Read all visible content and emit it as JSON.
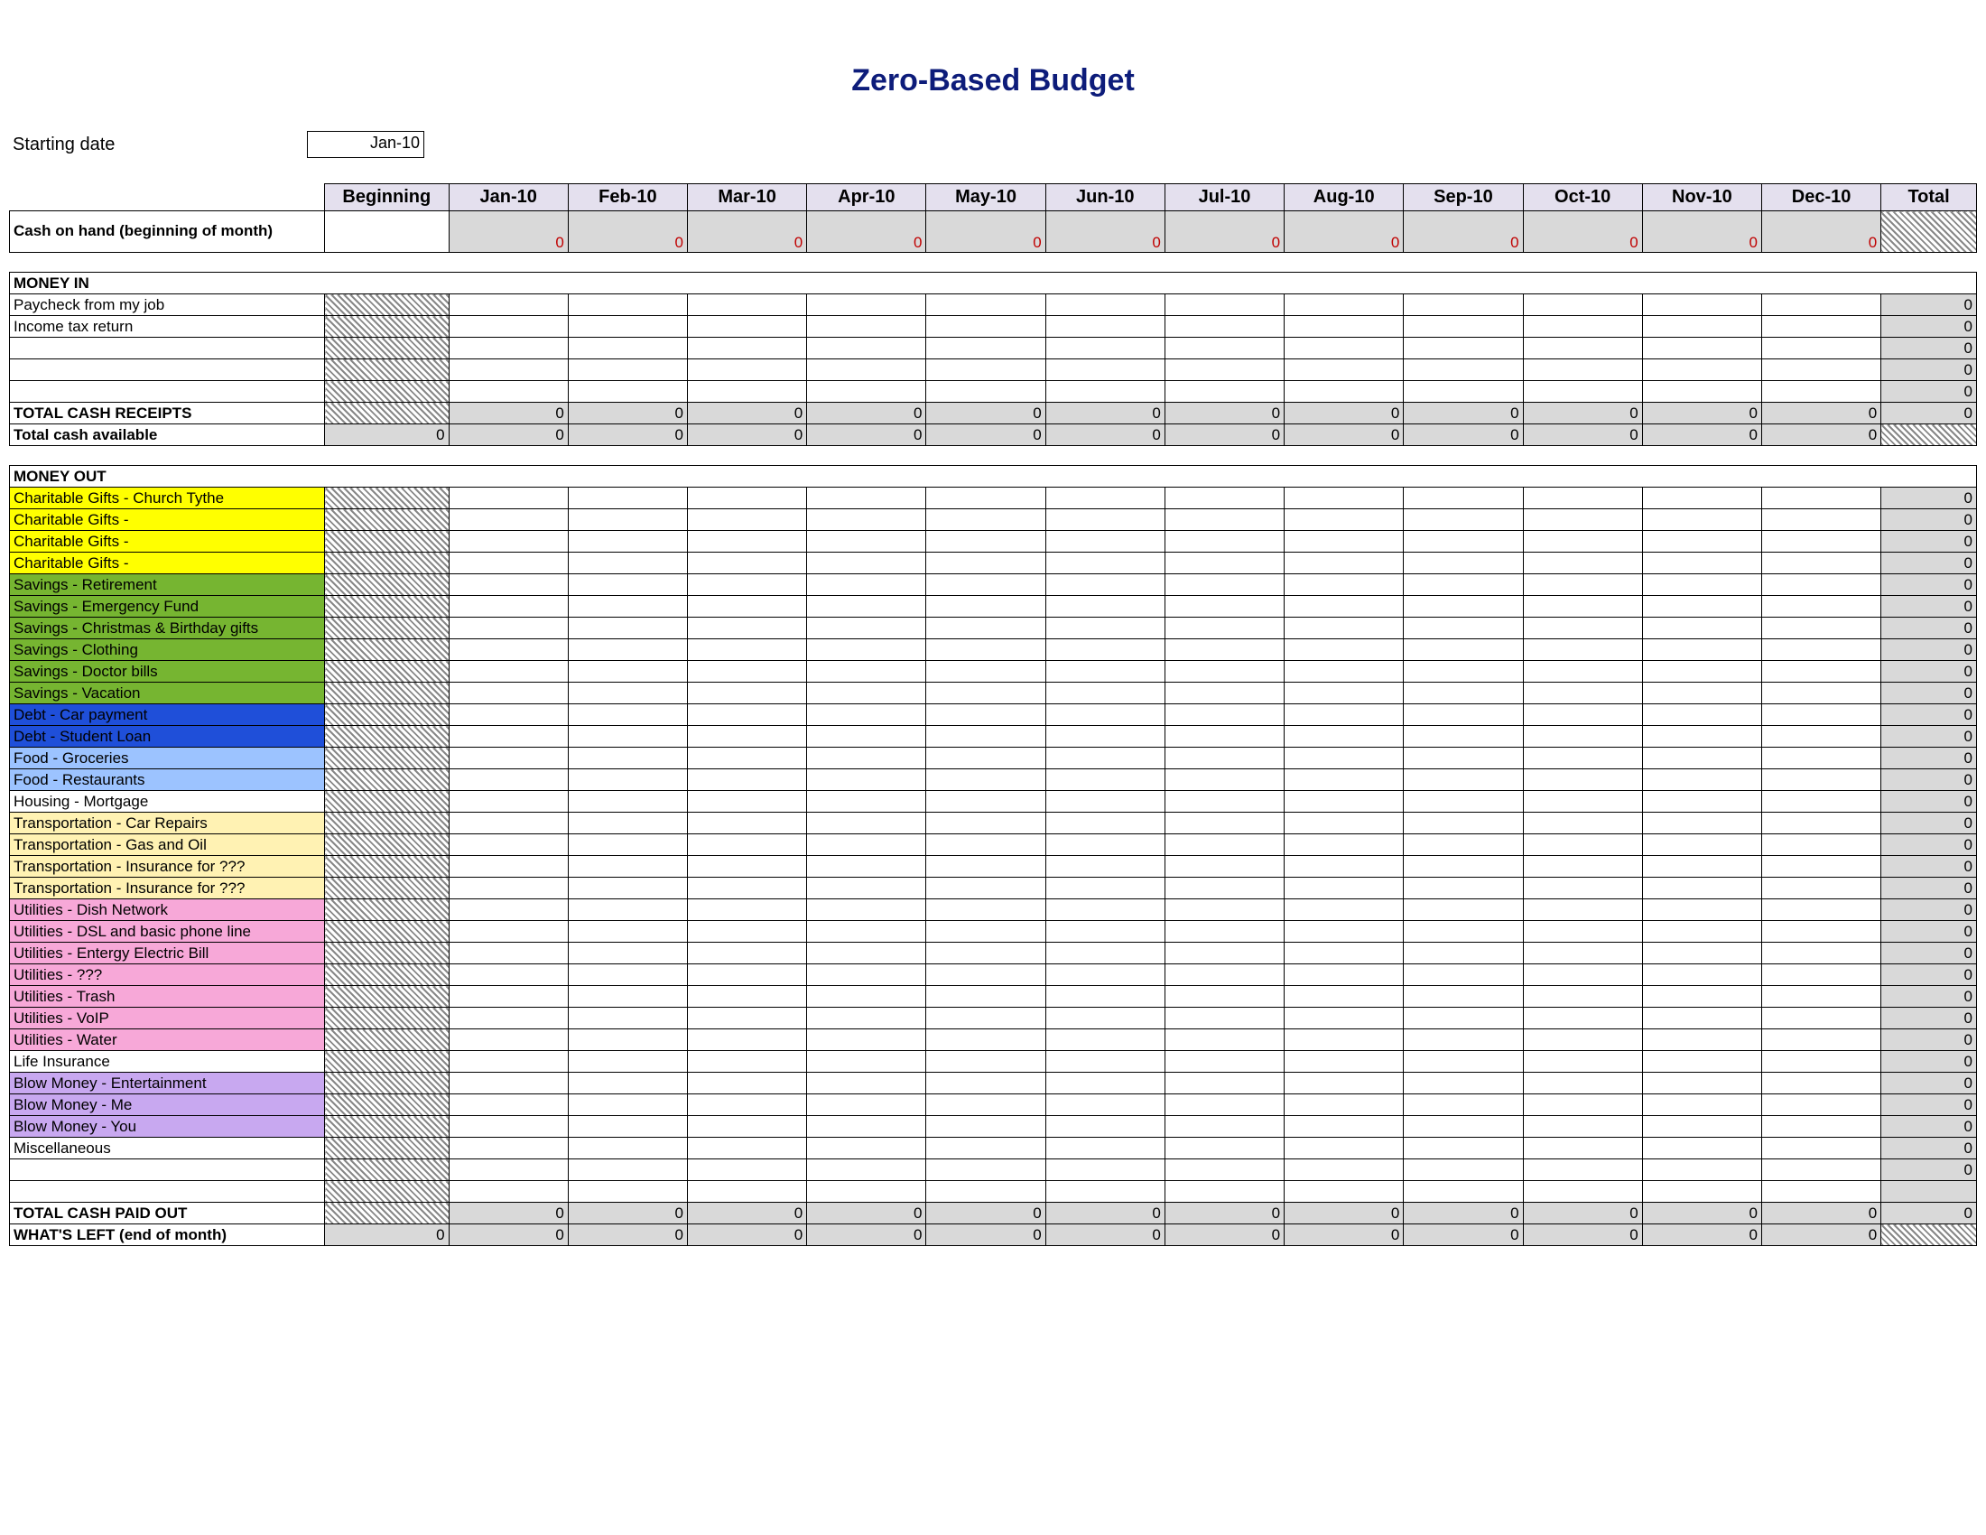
{
  "title": "Zero-Based Budget",
  "starting_date_label": "Starting date",
  "starting_date_value": "Jan-10",
  "columns": {
    "begin": "Beginning",
    "months": [
      "Jan-10",
      "Feb-10",
      "Mar-10",
      "Apr-10",
      "May-10",
      "Jun-10",
      "Jul-10",
      "Aug-10",
      "Sep-10",
      "Oct-10",
      "Nov-10",
      "Dec-10"
    ],
    "total": "Total"
  },
  "cash_on_hand_label": "Cash on hand (beginning of month)",
  "zero": "0",
  "sections": {
    "money_in": "MONEY IN",
    "money_out": "MONEY OUT"
  },
  "money_in_rows": [
    {
      "label": "Paycheck from my job",
      "total": "0"
    },
    {
      "label": "Income tax return",
      "total": "0"
    },
    {
      "label": "",
      "total": "0"
    },
    {
      "label": "",
      "total": "0"
    },
    {
      "label": "",
      "total": "0"
    }
  ],
  "total_cash_receipts_label": "TOTAL CASH RECEIPTS",
  "total_cash_available_label": "Total cash available",
  "money_out_rows": [
    {
      "label": "Charitable Gifts - Church Tythe",
      "color": "c-yellow",
      "total": "0"
    },
    {
      "label": "Charitable Gifts -",
      "color": "c-yellow",
      "total": "0"
    },
    {
      "label": "Charitable Gifts -",
      "color": "c-yellow",
      "total": "0"
    },
    {
      "label": "Charitable Gifts -",
      "color": "c-yellow",
      "total": "0"
    },
    {
      "label": "Savings - Retirement",
      "color": "c-green",
      "total": "0"
    },
    {
      "label": "Savings - Emergency Fund",
      "color": "c-green",
      "total": "0"
    },
    {
      "label": "Savings - Christmas & Birthday gifts",
      "color": "c-green",
      "total": "0"
    },
    {
      "label": "Savings - Clothing",
      "color": "c-green",
      "total": "0"
    },
    {
      "label": "Savings - Doctor bills",
      "color": "c-green",
      "total": "0"
    },
    {
      "label": "Savings - Vacation",
      "color": "c-green",
      "total": "0"
    },
    {
      "label": "Debt - Car payment",
      "color": "c-blue",
      "total": "0"
    },
    {
      "label": "Debt - Student Loan",
      "color": "c-blue",
      "total": "0"
    },
    {
      "label": "Food - Groceries",
      "color": "c-lblue",
      "total": "0"
    },
    {
      "label": "Food - Restaurants",
      "color": "c-lblue",
      "total": "0"
    },
    {
      "label": "Housing - Mortgage",
      "color": "c-white",
      "total": "0"
    },
    {
      "label": "Transportation - Car Repairs",
      "color": "c-cream",
      "total": "0"
    },
    {
      "label": "Transportation - Gas and Oil",
      "color": "c-cream",
      "total": "0"
    },
    {
      "label": "Transportation - Insurance for ???",
      "color": "c-cream",
      "total": "0"
    },
    {
      "label": "Transportation - Insurance for ???",
      "color": "c-cream",
      "total": "0"
    },
    {
      "label": "Utilities - Dish Network",
      "color": "c-pink",
      "total": "0"
    },
    {
      "label": "Utilities - DSL and basic phone line",
      "color": "c-pink",
      "total": "0"
    },
    {
      "label": "Utilities - Entergy Electric Bill",
      "color": "c-pink",
      "total": "0"
    },
    {
      "label": "Utilities - ???",
      "color": "c-pink",
      "total": "0"
    },
    {
      "label": "Utilities - Trash",
      "color": "c-pink",
      "total": "0"
    },
    {
      "label": "Utilities - VoIP",
      "color": "c-pink",
      "total": "0"
    },
    {
      "label": "Utilities - Water",
      "color": "c-pink",
      "total": "0"
    },
    {
      "label": "Life Insurance",
      "color": "c-white",
      "total": "0"
    },
    {
      "label": "Blow Money - Entertainment",
      "color": "c-purple",
      "total": "0"
    },
    {
      "label": "Blow Money - Me",
      "color": "c-purple",
      "total": "0"
    },
    {
      "label": "Blow Money - You",
      "color": "c-purple",
      "total": "0"
    },
    {
      "label": "Miscellaneous",
      "color": "c-white",
      "total": "0"
    },
    {
      "label": "",
      "color": "c-white",
      "total": "0"
    }
  ],
  "total_cash_paid_out_label": "TOTAL CASH PAID OUT",
  "whats_left_label": "WHAT'S LEFT (end of month)"
}
